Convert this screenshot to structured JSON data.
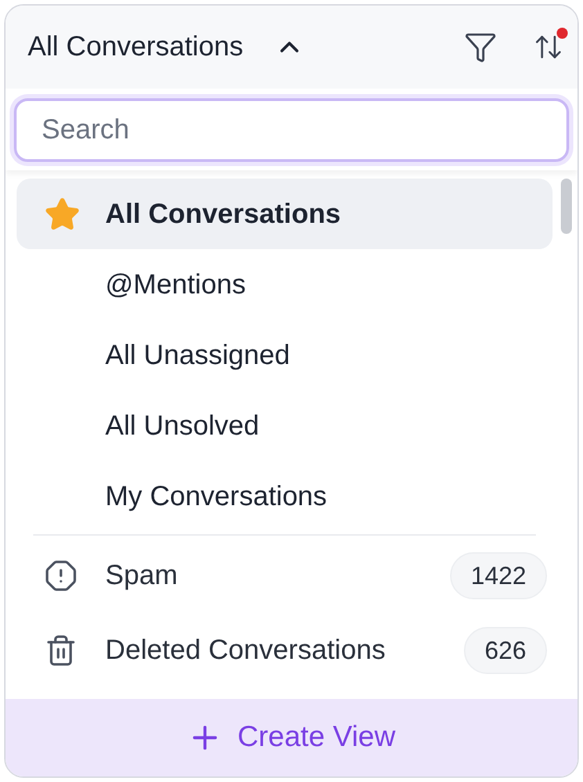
{
  "header": {
    "title": "All Conversations",
    "expanded": true,
    "sort_alert": true
  },
  "search": {
    "placeholder": "Search"
  },
  "views": [
    {
      "label": "All Conversations",
      "selected": true,
      "starred": true
    },
    {
      "label": "@Mentions",
      "selected": false,
      "starred": false
    },
    {
      "label": "All Unassigned",
      "selected": false,
      "starred": false
    },
    {
      "label": "All Unsolved",
      "selected": false,
      "starred": false
    },
    {
      "label": "My Conversations",
      "selected": false,
      "starred": false
    }
  ],
  "folders": [
    {
      "kind": "spam",
      "label": "Spam",
      "count": "1422"
    },
    {
      "kind": "trash",
      "label": "Deleted Conversations",
      "count": "626"
    }
  ],
  "footer": {
    "label": "Create View"
  }
}
